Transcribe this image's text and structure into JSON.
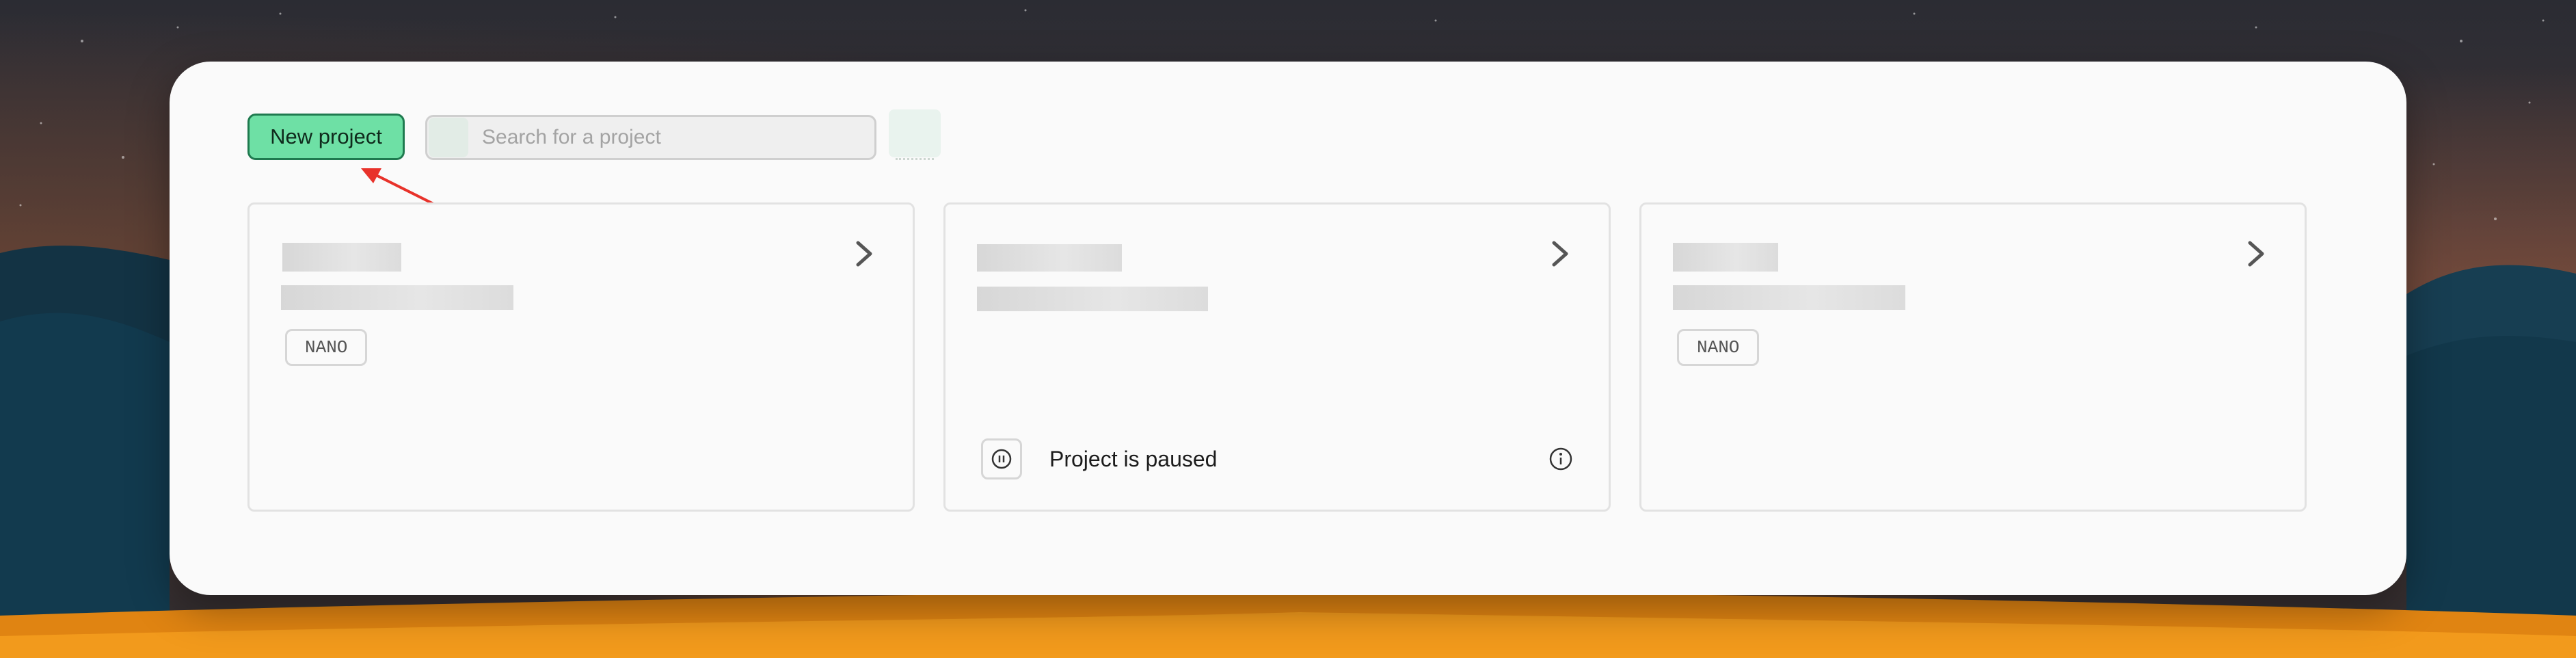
{
  "toolbar": {
    "new_project_label": "New project",
    "search_placeholder": "Search for a project",
    "search_value": ""
  },
  "projects": [
    {
      "tier": "NANO",
      "status": "",
      "icon": "chevron-right-icon"
    },
    {
      "tier": "",
      "status": "Project is paused",
      "icon": "chevron-right-icon",
      "status_icon": "pause-icon",
      "info_icon": "info-icon"
    },
    {
      "tier": "NANO",
      "status": "",
      "icon": "chevron-right-icon"
    }
  ],
  "colors": {
    "accent": "#6ee0a5",
    "accent_border": "#1f7a4f",
    "annotation_arrow": "#e8322a",
    "card_background": "#fafafa"
  }
}
